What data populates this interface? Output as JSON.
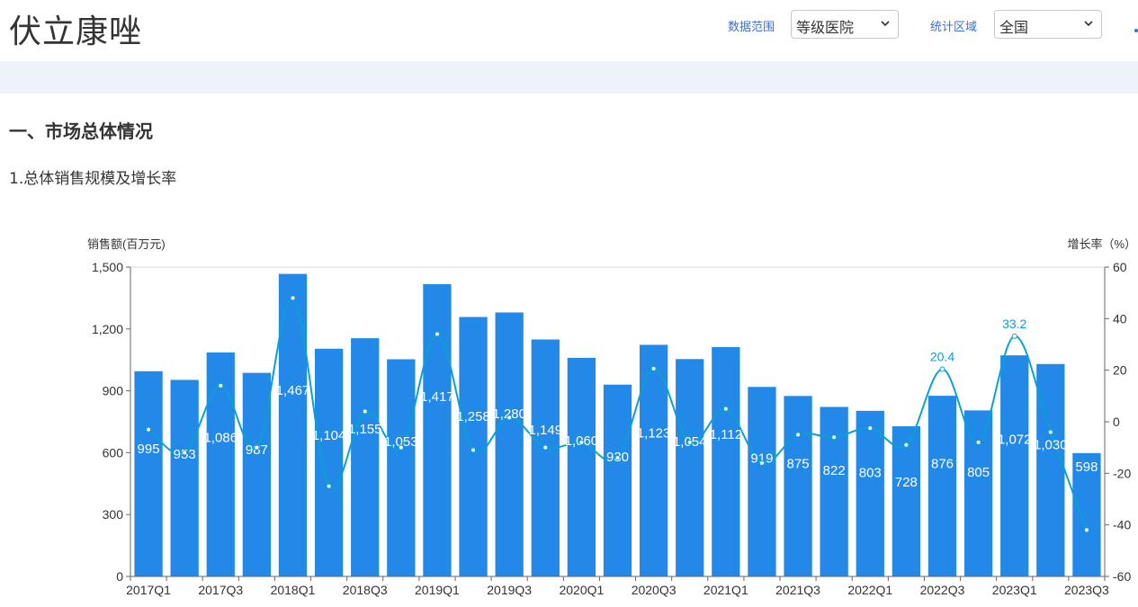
{
  "header": {
    "title": "伏立康唑",
    "data_range_label": "数据范围",
    "data_range_value": "等级医院",
    "region_label": "统计区域",
    "region_value": "全国"
  },
  "section": {
    "heading": "一、市场总体情况",
    "subheading": "1.总体销售规模及增长率"
  },
  "colors": {
    "bar": "#2389e8",
    "line": "#0aa0d2",
    "link": "#3a6fd4",
    "band": "#eef2fb"
  },
  "chart_data": {
    "type": "bar",
    "title": "",
    "ylabel": "销售额(百万元)",
    "ylabel_right": "增长率（%）",
    "ylim": [
      0,
      1500
    ],
    "ylim_right": [
      -60,
      60
    ],
    "yticks": [
      "0",
      "300",
      "600",
      "900",
      "1,200",
      "1,500"
    ],
    "yticks_right": [
      "-60",
      "-40",
      "-20",
      "0",
      "20",
      "40",
      "60"
    ],
    "categories": [
      "2017Q1",
      "2017Q2",
      "2017Q3",
      "2017Q4",
      "2018Q1",
      "2018Q2",
      "2018Q3",
      "2018Q4",
      "2019Q1",
      "2019Q2",
      "2019Q3",
      "2019Q4",
      "2020Q1",
      "2020Q2",
      "2020Q3",
      "2020Q4",
      "2021Q1",
      "2021Q2",
      "2021Q3",
      "2021Q4",
      "2022Q1",
      "2022Q2",
      "2022Q3",
      "2022Q4",
      "2023Q1",
      "2023Q2",
      "2023Q3"
    ],
    "xtick_labels": [
      "2017Q1",
      "",
      "2017Q3",
      "",
      "2018Q1",
      "",
      "2018Q3",
      "",
      "2019Q1",
      "",
      "2019Q3",
      "",
      "2020Q1",
      "",
      "2020Q3",
      "",
      "2021Q1",
      "",
      "2021Q3",
      "",
      "2022Q1",
      "",
      "2022Q3",
      "",
      "2023Q1",
      "",
      "2023Q3"
    ],
    "series": [
      {
        "type": "bar",
        "values": [
          995,
          953,
          1086,
          987,
          1467,
          1104,
          1155,
          1053,
          1417,
          1258,
          1280,
          1149,
          1060,
          930,
          1123,
          1054,
          1112,
          919,
          875,
          822,
          803,
          728,
          876,
          805,
          1072,
          1030,
          598
        ],
        "labels": [
          "995",
          "953",
          "1,086",
          "987",
          "1,467",
          "1,104",
          "1,155",
          "1,053",
          "1,417",
          "1,258",
          "1,280",
          "1,149",
          "1,060",
          "930",
          "1,123",
          "1,054",
          "1,112",
          "919",
          "875",
          "822",
          "803",
          "728",
          "876",
          "805",
          "1,072",
          "1,030",
          "598"
        ]
      },
      {
        "type": "line",
        "axis": "right",
        "values": [
          -3,
          -12,
          14,
          -10,
          48,
          -25,
          4,
          -10,
          34,
          -11,
          1.6,
          -10,
          -8,
          -14,
          20.6,
          -8,
          5,
          -16,
          -5,
          -6,
          -2.5,
          -9,
          20.4,
          -8,
          33.2,
          -4,
          -42
        ],
        "labels": [
          "",
          "",
          "",
          "",
          "",
          "",
          "",
          "",
          "",
          "",
          "",
          "",
          "",
          "",
          "",
          "",
          "",
          "",
          "",
          "",
          "",
          "",
          "20.4",
          "",
          "33.2",
          "",
          ""
        ]
      }
    ],
    "grid": false,
    "legend": "none"
  }
}
